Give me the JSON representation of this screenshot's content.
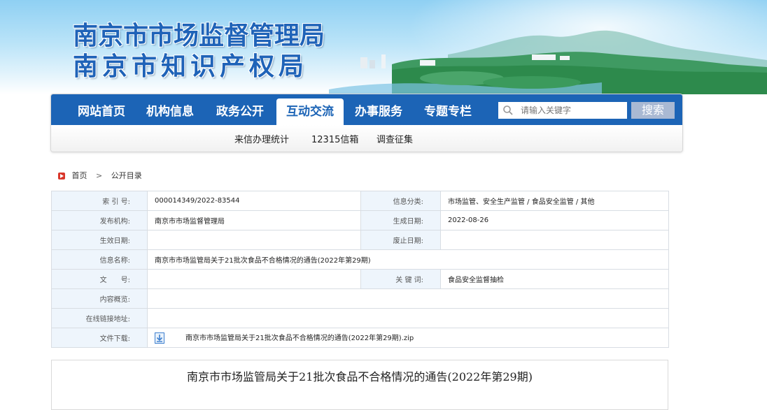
{
  "banner": {
    "title_line1": "南京市市场监督管理局",
    "title_line2": "南京市知识产权局"
  },
  "nav": {
    "items": [
      {
        "label": "网站首页"
      },
      {
        "label": "机构信息"
      },
      {
        "label": "政务公开"
      },
      {
        "label": "互动交流",
        "active": true
      },
      {
        "label": "办事服务"
      },
      {
        "label": "专题专栏"
      }
    ],
    "search": {
      "placeholder": "请输入关键字",
      "icon": "search-icon",
      "button_label": "搜索"
    },
    "subnav": [
      {
        "label": "来信办理统计"
      },
      {
        "label": "12315信箱"
      },
      {
        "label": "调查征集"
      }
    ]
  },
  "breadcrumb": {
    "icon": "home-icon",
    "home": "首页",
    "separator": ">",
    "current": "公开目录"
  },
  "info": {
    "index_label": "索 引 号:",
    "index_value": "000014349/2022-83544",
    "category_label": "信息分类:",
    "category_value": "市场监管、安全生产监管 / 食品安全监管 / 其他",
    "publisher_label": "发布机构:",
    "publisher_value": "南京市市场监督管理局",
    "created_label": "生成日期:",
    "created_value": "2022-08-26",
    "effective_label": "生效日期:",
    "effective_value": "",
    "expire_label": "废止日期:",
    "expire_value": "",
    "name_label": "信息名称:",
    "name_value": "南京市市场监管局关于21批次食品不合格情况的通告(2022年第29期)",
    "docno_label": "文　　号:",
    "docno_value": "",
    "keywords_label": "关 键 词:",
    "keywords_value": "食品安全监督抽检",
    "summary_label": "内容概览:",
    "summary_value": "",
    "link_label": "在线链接地址:",
    "link_value": "",
    "file_label": "文件下载:",
    "file_icon": "download-icon",
    "file_value": "南京市市场监管局关于21批次食品不合格情况的通告(2022年第29期).zip"
  },
  "article": {
    "title": "南京市市场监管局关于21批次食品不合格情况的通告(2022年第29期)"
  },
  "colors": {
    "nav_blue": "#1c64b6",
    "label_bg": "#eef5fc",
    "search_btn": "#a9b9d3"
  }
}
